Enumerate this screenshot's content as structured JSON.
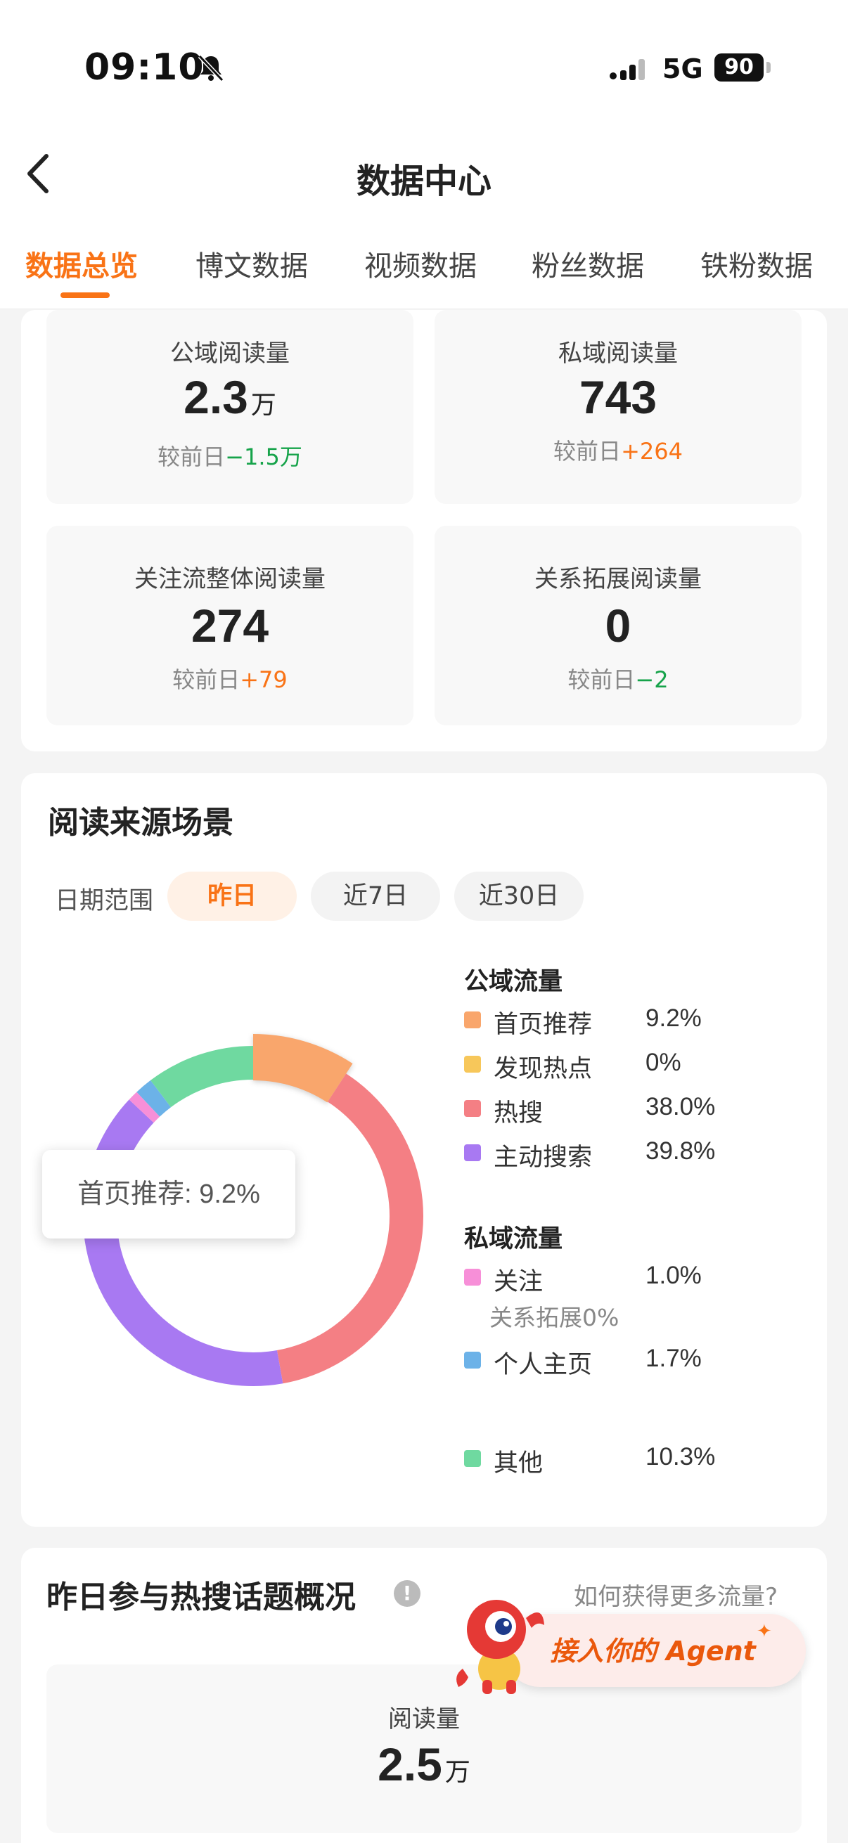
{
  "status_bar": {
    "time": "09:10",
    "network": "5G",
    "battery": "90"
  },
  "header": {
    "title": "数据中心"
  },
  "tabs": [
    {
      "label": "数据总览",
      "active": true
    },
    {
      "label": "博文数据"
    },
    {
      "label": "视频数据"
    },
    {
      "label": "粉丝数据"
    },
    {
      "label": "铁粉数据"
    }
  ],
  "stats": [
    {
      "label": "公域阅读量",
      "value": "2.3",
      "unit": "万",
      "compare_prefix": "较前日",
      "compare": "−1.5万"
    },
    {
      "label": "私域阅读量",
      "value": "743",
      "unit": "",
      "compare_prefix": "较前日",
      "compare": "+264"
    },
    {
      "label": "关注流整体阅读量",
      "value": "274",
      "unit": "",
      "compare_prefix": "较前日",
      "compare": "+79"
    },
    {
      "label": "关系拓展阅读量",
      "value": "0",
      "unit": "",
      "compare_prefix": "较前日",
      "compare": "−2"
    }
  ],
  "read_source": {
    "title": "阅读来源场景",
    "date_range_label": "日期范围",
    "date_options": [
      "昨日",
      "近7日",
      "近30日"
    ],
    "selected_date": "昨日",
    "tooltip": "首页推荐: 9.2%",
    "public_traffic_label": "公域流量",
    "private_traffic_label": "私域流量",
    "relation_note": "关系拓展0%",
    "legend": [
      {
        "name": "首页推荐",
        "pct": "9.2%",
        "color": "#f9a66c"
      },
      {
        "name": "发现热点",
        "pct": "0%",
        "color": "#f7c75a"
      },
      {
        "name": "热搜",
        "pct": "38.0%",
        "color": "#f47f84"
      },
      {
        "name": "主动搜索",
        "pct": "39.8%",
        "color": "#a879f2"
      },
      {
        "name": "关注",
        "pct": "1.0%",
        "color": "#f78fd8"
      },
      {
        "name": "个人主页",
        "pct": "1.7%",
        "color": "#6cb2e8"
      },
      {
        "name": "其他",
        "pct": "10.3%",
        "color": "#6fd9a0"
      }
    ]
  },
  "chart_data": {
    "type": "pie",
    "categories": [
      "首页推荐",
      "发现热点",
      "热搜",
      "主动搜索",
      "关注",
      "个人主页",
      "其他"
    ],
    "values": [
      9.2,
      0,
      38.0,
      39.8,
      1.0,
      1.7,
      10.3
    ],
    "colors": [
      "#f9a66c",
      "#f7c75a",
      "#f47f84",
      "#a879f2",
      "#f78fd8",
      "#6cb2e8",
      "#6fd9a0"
    ],
    "highlighted": "首页推荐"
  },
  "hot_topics": {
    "title": "昨日参与热搜话题概况",
    "more_link": "如何获得更多流量?",
    "read_label": "阅读量",
    "read_value": "2.5",
    "read_unit": "万"
  },
  "agent_banner": {
    "text": "接入你的 Agent"
  }
}
